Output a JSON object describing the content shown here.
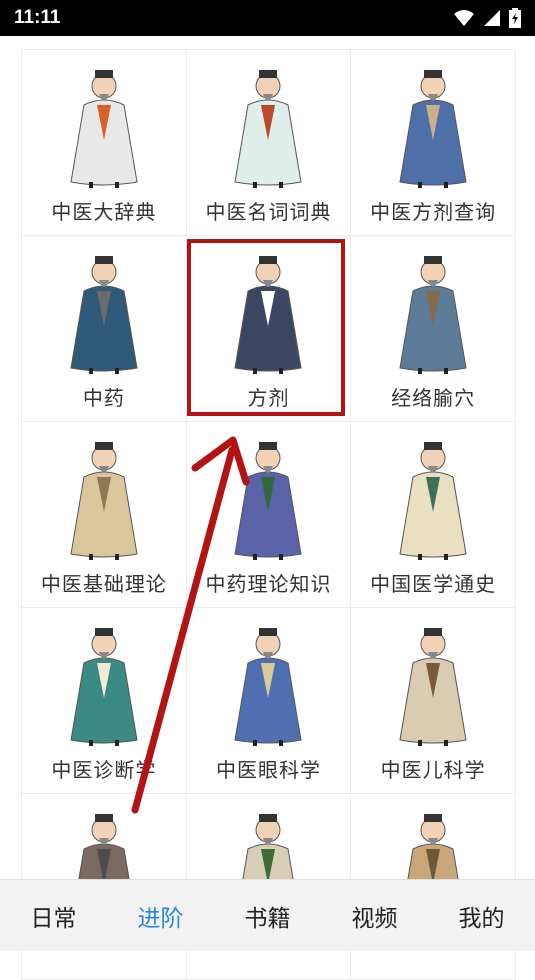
{
  "status_bar": {
    "time": "11:11"
  },
  "grid": {
    "items": [
      {
        "label": "中医大辞典",
        "icon": "sage-icon",
        "robe": "#e8e8e8",
        "accent": "#d9622b"
      },
      {
        "label": "中医名词词典",
        "icon": "sage-icon",
        "robe": "#dfeee8",
        "accent": "#b84a2b"
      },
      {
        "label": "中医方剂查询",
        "icon": "sage-icon",
        "robe": "#4f6fa8",
        "accent": "#c9b08a"
      },
      {
        "label": "中药",
        "icon": "herbalist-icon",
        "robe": "#2f5a7a",
        "accent": "#6b6b6b"
      },
      {
        "label": "方剂",
        "icon": "herbalist-icon",
        "robe": "#3b4660",
        "accent": "#ffffff"
      },
      {
        "label": "经络腧穴",
        "icon": "sage-icon",
        "robe": "#5d7c99",
        "accent": "#8a6a4a"
      },
      {
        "label": "中医基础理论",
        "icon": "sage-icon",
        "robe": "#d9c69a",
        "accent": "#8c7a55"
      },
      {
        "label": "中药理论知识",
        "icon": "sage-icon",
        "robe": "#5a63a8",
        "accent": "#2f6b3a"
      },
      {
        "label": "中国医学通史",
        "icon": "sage-icon",
        "robe": "#e8e0c0",
        "accent": "#3e6f5f"
      },
      {
        "label": "中医诊断学",
        "icon": "sage-icon",
        "robe": "#3c8a86",
        "accent": "#f2ead2"
      },
      {
        "label": "中医眼科学",
        "icon": "sage-icon",
        "robe": "#4f6fb0",
        "accent": "#d8c89a"
      },
      {
        "label": "中医儿科学",
        "icon": "sage-icon",
        "robe": "#d9ccb0",
        "accent": "#7a5a3a"
      },
      {
        "label": "",
        "icon": "sage-icon",
        "robe": "#7a6a63",
        "accent": "#4c4c4c"
      },
      {
        "label": "",
        "icon": "sage-icon",
        "robe": "#d8cdb5",
        "accent": "#3d6b3a"
      },
      {
        "label": "",
        "icon": "sage-icon",
        "robe": "#c9a77a",
        "accent": "#6b5a3a"
      }
    ]
  },
  "bottom_nav": {
    "items": [
      {
        "label": "日常"
      },
      {
        "label": "进阶",
        "active": true
      },
      {
        "label": "书籍"
      },
      {
        "label": "视频"
      },
      {
        "label": "我的"
      }
    ]
  },
  "colors": {
    "accent": "#2a86d8",
    "annotation": "#b31312"
  }
}
